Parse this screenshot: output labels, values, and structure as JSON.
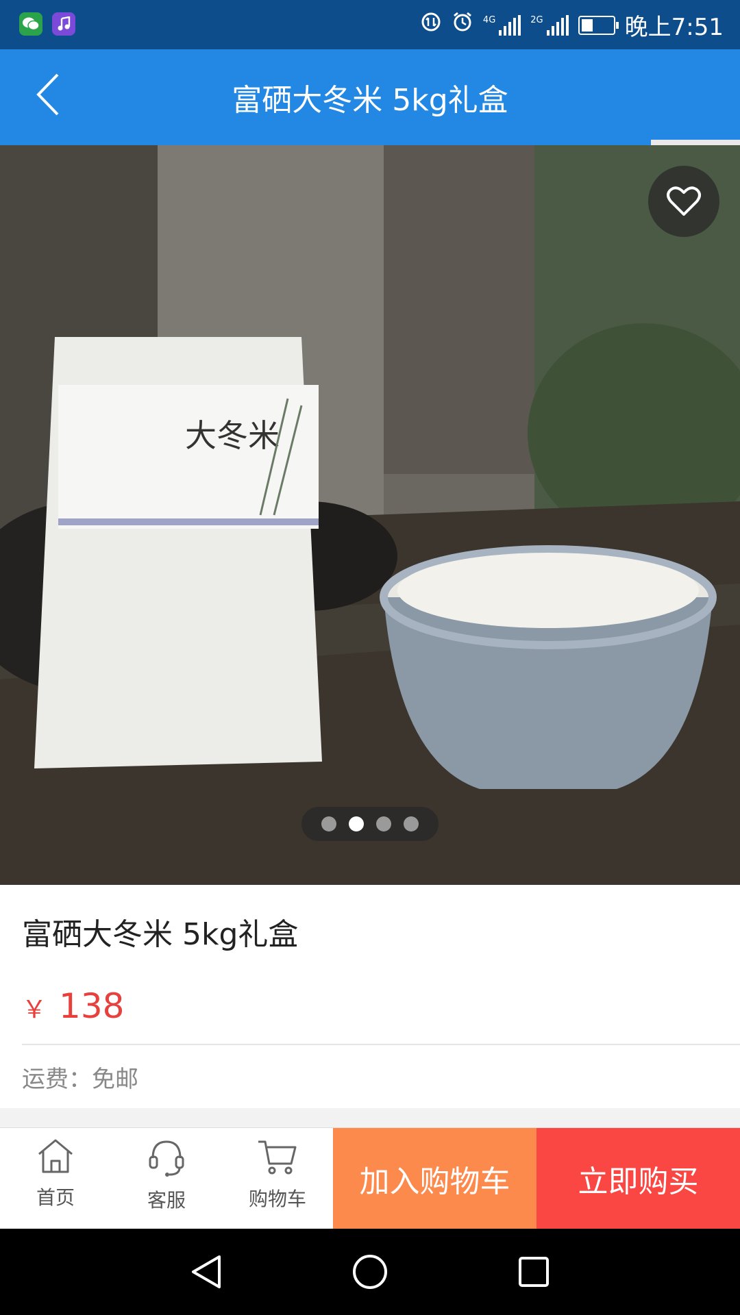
{
  "status_bar": {
    "time": "晚上7:51",
    "net_4g": "4G",
    "net_2g": "2G",
    "battery_level_percent": 38,
    "icons": [
      "wechat-icon",
      "music-icon",
      "data-saver-icon",
      "alarm-icon",
      "signal-4g-icon",
      "signal-2g-icon",
      "battery-icon"
    ]
  },
  "header": {
    "title": "富硒大冬米 5kg礼盒",
    "load_progress_percent": 88
  },
  "gallery": {
    "image_count": 4,
    "active_index": 1,
    "favorite_icon": "heart-outline-icon"
  },
  "product": {
    "title": "富硒大冬米 5kg礼盒",
    "currency": "￥",
    "price": "138",
    "shipping": "运费：免邮"
  },
  "bottom_nav": {
    "home": "首页",
    "service": "客服",
    "cart": "购物车",
    "add_to_cart": "加入购物车",
    "buy_now": "立即购买"
  },
  "colors": {
    "header_blue": "#2288e3",
    "status_blue": "#0e4d8c",
    "price_red": "#e8403c",
    "cart_orange": "#fd8a4d",
    "buy_red": "#fb4744"
  }
}
